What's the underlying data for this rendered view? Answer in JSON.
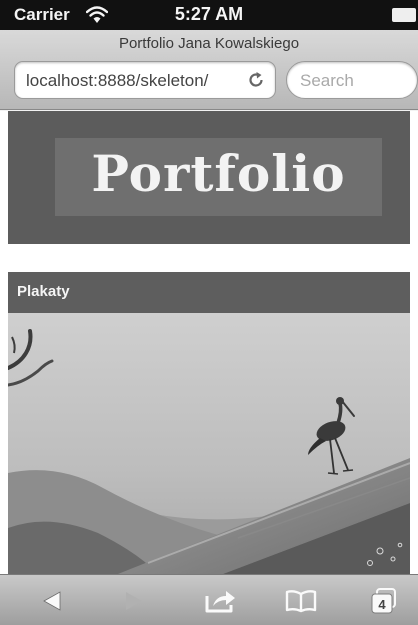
{
  "status_bar": {
    "carrier": "Carrier",
    "time": "5:27 AM"
  },
  "browser": {
    "page_title": "Portfolio Jana Kowalskiego",
    "address": "localhost:8888/skeleton/",
    "search_placeholder": "Search",
    "tab_count": "4"
  },
  "page": {
    "logo_text": "Portfolio",
    "section_title": "Plakaty"
  },
  "icons": {
    "wifi": "wifi-icon",
    "battery": "battery-icon",
    "reload": "reload-icon",
    "back": "back-arrow-icon",
    "forward": "forward-arrow-icon",
    "share": "share-icon",
    "bookmarks": "bookmarks-book-icon",
    "tabs": "tabs-icon"
  },
  "toolbar": {
    "back_enabled": true,
    "forward_enabled": false
  }
}
